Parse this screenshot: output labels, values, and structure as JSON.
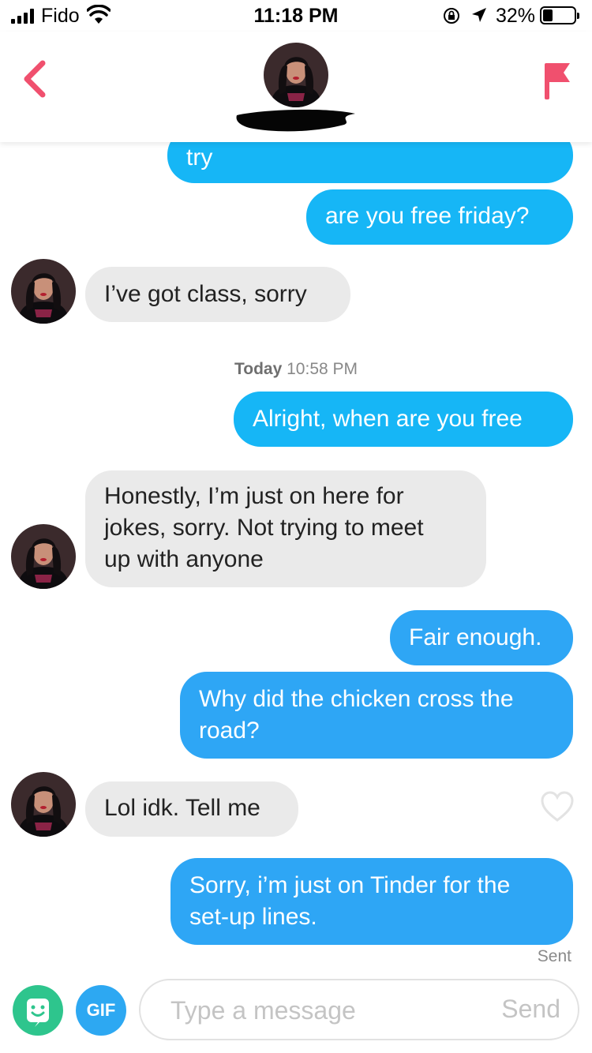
{
  "status_bar": {
    "carrier": "Fido",
    "time": "11:18 PM",
    "battery_percent": "32%",
    "battery_level": 0.32
  },
  "header": {
    "back_icon": "chevron-left-icon",
    "flag_icon": "flag-icon",
    "accent_color": "#f0506e"
  },
  "messages": [
    {
      "side": "out",
      "text": "try"
    },
    {
      "side": "out",
      "text": "are you free friday?"
    },
    {
      "side": "in",
      "text": "I’ve got class, sorry"
    },
    {
      "side": "out",
      "text": "Alright, when are you free"
    },
    {
      "side": "in",
      "lines": [
        "Honestly, I’m just on here for",
        "jokes, sorry. Not trying to meet",
        "up with anyone"
      ]
    },
    {
      "side": "out",
      "text": "Fair enough."
    },
    {
      "side": "out",
      "lines": [
        "Why did the chicken cross the",
        "road?"
      ]
    },
    {
      "side": "in",
      "text": "Lol idk. Tell me"
    },
    {
      "side": "out",
      "lines": [
        "Sorry, i’m just on Tinder for the",
        "set-up lines."
      ]
    }
  ],
  "timestamp": {
    "day": "Today",
    "time": "10:58 PM"
  },
  "sent_label": "Sent",
  "composer": {
    "gif_label": "GIF",
    "placeholder": "Type a message",
    "send_label": "Send"
  },
  "colors": {
    "outgoing_bubble": "#16b6f6",
    "incoming_bubble": "#eaeaea",
    "sticker_button": "#2ec58d",
    "gif_button": "#2da8f2"
  }
}
